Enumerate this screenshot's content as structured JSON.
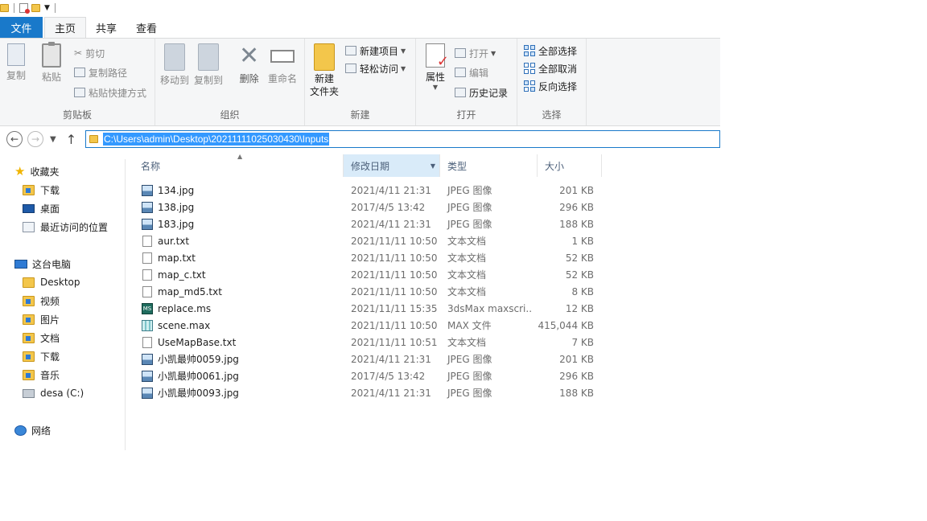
{
  "tabs": {
    "file": "文件",
    "home": "主页",
    "share": "共享",
    "view": "查看"
  },
  "ribbon": {
    "clipboard": {
      "label": "剪贴板",
      "copy": "复制",
      "paste": "粘贴",
      "cut": "剪切",
      "copy_path": "复制路径",
      "paste_shortcut": "粘贴快捷方式"
    },
    "organize": {
      "label": "组织",
      "move_to": "移动到",
      "copy_to": "复制到",
      "delete": "删除",
      "rename": "重命名"
    },
    "new": {
      "label": "新建",
      "new_folder_line1": "新建",
      "new_folder_line2": "文件夹",
      "new_item": "新建项目",
      "easy_access": "轻松访问"
    },
    "open": {
      "label": "打开",
      "properties": "属性",
      "open": "打开",
      "edit": "编辑",
      "history": "历史记录"
    },
    "select": {
      "label": "选择",
      "select_all": "全部选择",
      "select_none": "全部取消",
      "invert": "反向选择"
    }
  },
  "address": {
    "path": "C:\\Users\\admin\\Desktop\\20211111025030430\\Inputs"
  },
  "sidebar": {
    "favorites": "收藏夹",
    "fav_items": [
      "下载",
      "桌面",
      "最近访问的位置"
    ],
    "this_pc": "这台电脑",
    "pc_items": [
      "Desktop",
      "视频",
      "图片",
      "文档",
      "下载",
      "音乐",
      "desa (C:)"
    ],
    "network": "网络"
  },
  "columns": {
    "name": "名称",
    "date": "修改日期",
    "type": "类型",
    "size": "大小"
  },
  "files": [
    {
      "name": "134.jpg",
      "date": "2021/4/11 21:31",
      "type": "JPEG 图像",
      "size": "201 KB",
      "icon": "img"
    },
    {
      "name": "138.jpg",
      "date": "2017/4/5 13:42",
      "type": "JPEG 图像",
      "size": "296 KB",
      "icon": "img"
    },
    {
      "name": "183.jpg",
      "date": "2021/4/11 21:31",
      "type": "JPEG 图像",
      "size": "188 KB",
      "icon": "img"
    },
    {
      "name": "aur.txt",
      "date": "2021/11/11 10:50",
      "type": "文本文档",
      "size": "1 KB",
      "icon": "txt"
    },
    {
      "name": "map.txt",
      "date": "2021/11/11 10:50",
      "type": "文本文档",
      "size": "52 KB",
      "icon": "txt"
    },
    {
      "name": "map_c.txt",
      "date": "2021/11/11 10:50",
      "type": "文本文档",
      "size": "52 KB",
      "icon": "txt"
    },
    {
      "name": "map_md5.txt",
      "date": "2021/11/11 10:50",
      "type": "文本文档",
      "size": "8 KB",
      "icon": "txt"
    },
    {
      "name": "replace.ms",
      "date": "2021/11/11 15:35",
      "type": "3dsMax maxscri...",
      "size": "12 KB",
      "icon": "ms"
    },
    {
      "name": "scene.max",
      "date": "2021/11/11 10:50",
      "type": "MAX 文件",
      "size": "415,044 KB",
      "icon": "max"
    },
    {
      "name": "UseMapBase.txt",
      "date": "2021/11/11 10:51",
      "type": "文本文档",
      "size": "7 KB",
      "icon": "txt"
    },
    {
      "name": "小凯最帅0059.jpg",
      "date": "2021/4/11 21:31",
      "type": "JPEG 图像",
      "size": "201 KB",
      "icon": "img"
    },
    {
      "name": "小凯最帅0061.jpg",
      "date": "2017/4/5 13:42",
      "type": "JPEG 图像",
      "size": "296 KB",
      "icon": "img"
    },
    {
      "name": "小凯最帅0093.jpg",
      "date": "2021/4/11 21:31",
      "type": "JPEG 图像",
      "size": "188 KB",
      "icon": "img"
    }
  ]
}
